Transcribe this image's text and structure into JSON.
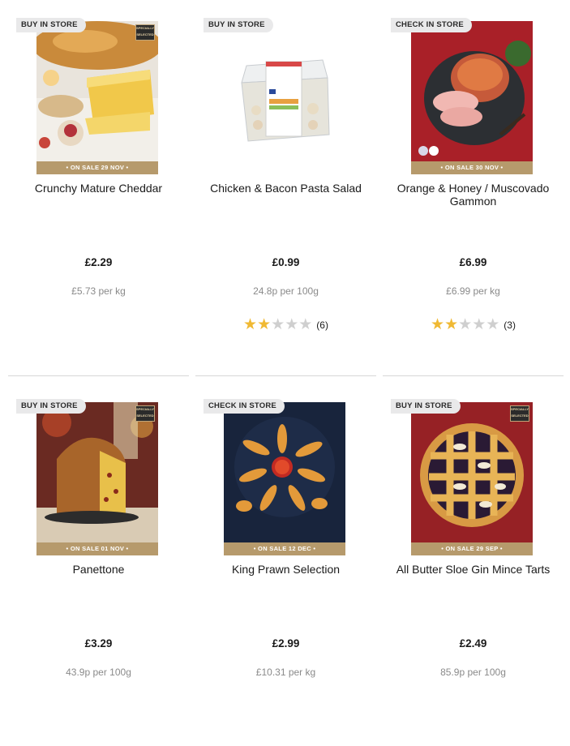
{
  "products": [
    {
      "badge": "BUY IN STORE",
      "sale": "• ON SALE 29 NOV •",
      "name": "Crunchy Mature Cheddar",
      "price": "£2.29",
      "unit_price": "£5.73 per kg",
      "rating": null,
      "logo": "SPECIALLY SELECTED"
    },
    {
      "badge": "BUY IN STORE",
      "sale": "",
      "name": "Chicken & Bacon Pasta Salad",
      "price": "£0.99",
      "unit_price": "24.8p per 100g",
      "rating": {
        "stars": 2,
        "count": "(6)"
      },
      "logo": ""
    },
    {
      "badge": "CHECK IN STORE",
      "sale": "• ON SALE 30 NOV •",
      "name": "Orange & Honey / Muscovado Gammon",
      "price": "£6.99",
      "unit_price": "£6.99 per kg",
      "rating": {
        "stars": 2,
        "count": "(3)"
      },
      "logo": ""
    },
    {
      "badge": "BUY IN STORE",
      "sale": "• ON SALE 01 NOV •",
      "name": "Panettone",
      "price": "£3.29",
      "unit_price": "43.9p per 100g",
      "rating": null,
      "logo": "SPECIALLY SELECTED"
    },
    {
      "badge": "CHECK IN STORE",
      "sale": "• ON SALE 12 DEC •",
      "name": "King Prawn Selection",
      "price": "£2.99",
      "unit_price": "£10.31 per kg",
      "rating": null,
      "logo": ""
    },
    {
      "badge": "BUY IN STORE",
      "sale": "• ON SALE 29 SEP •",
      "name": "All Butter Sloe Gin Mince Tarts",
      "price": "£2.49",
      "unit_price": "85.9p per 100g",
      "rating": null,
      "logo": "SPECIALLY SELECTED"
    }
  ],
  "colors": {
    "badge_bg": "#e9e9ea",
    "sale_bar": "#b69a6c",
    "star": "#f0b933",
    "star_empty": "#cfcfcf",
    "unit_text": "#8a8a8a"
  }
}
